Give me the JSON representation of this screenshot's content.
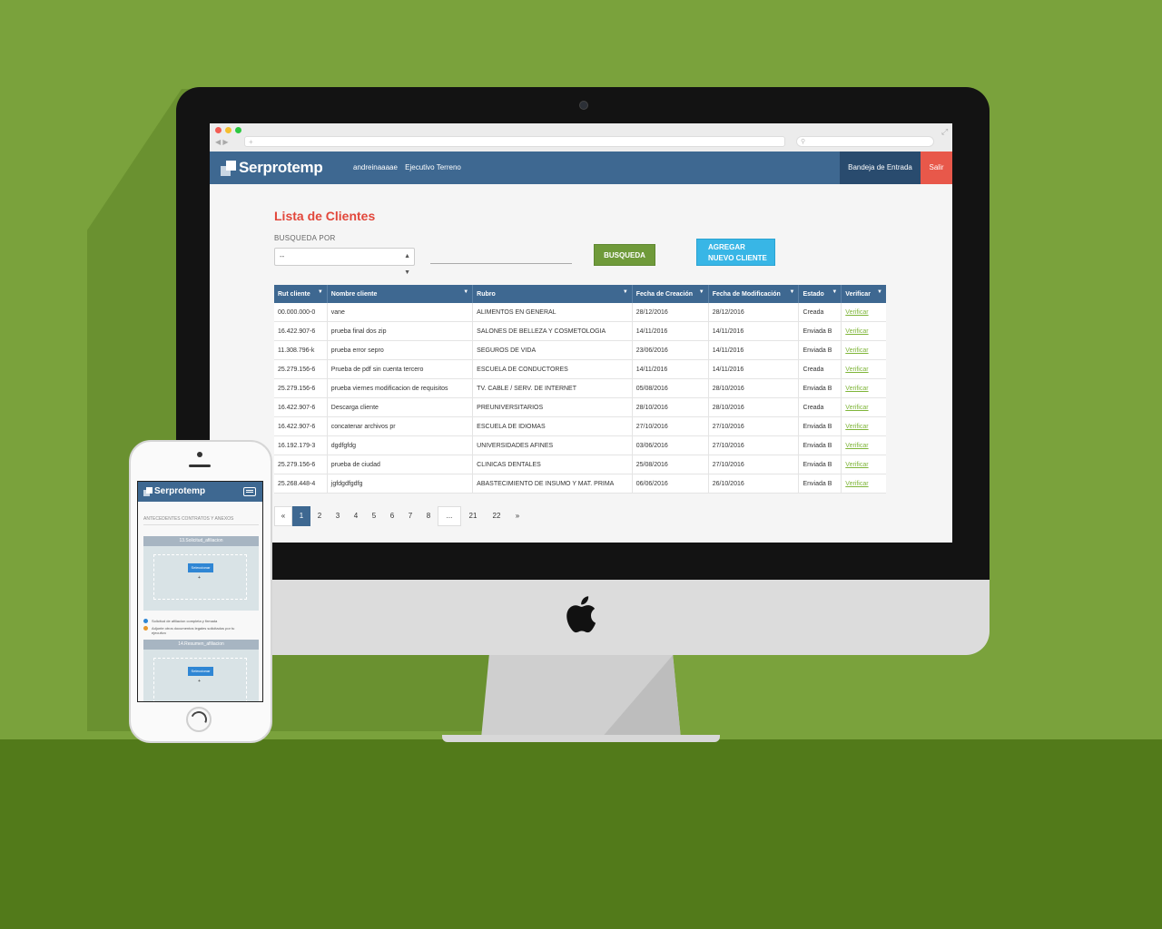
{
  "browser": {
    "url_placeholder": "+",
    "search_placeholder": "",
    "colors": {
      "close": "#f35c54",
      "minimize": "#f5be2f",
      "maximize": "#2bc840"
    }
  },
  "app": {
    "logo_text": "Serprotemp",
    "username": "andreinaaaae",
    "role": "Ejecutivo Terreno",
    "inbox_label": "Bandeja de Entrada",
    "exit_label": "Salir",
    "accent_color": "#3e6891",
    "danger_color": "#e8584a"
  },
  "page": {
    "title": "Lista de Clientes",
    "search_label": "BUSQUEDA POR",
    "select_value": "--",
    "search_button": "BUSQUEDA",
    "add_button_line1": "AGREGAR",
    "add_button_line2": "NUEVO CLIENTE"
  },
  "table": {
    "headers": [
      "Rut cliente",
      "Nombre cliente",
      "Rubro",
      "Fecha de Creación",
      "Fecha de Modificación",
      "Estado",
      "Verificar"
    ],
    "rows": [
      [
        "00.000.000-0",
        "vane",
        "ALIMENTOS EN GENERAL",
        "28/12/2016",
        "28/12/2016",
        "Creada",
        "Verificar"
      ],
      [
        "16.422.907-6",
        "prueba final dos zip",
        "SALONES DE BELLEZA Y COSMETOLOGIA",
        "14/11/2016",
        "14/11/2016",
        "Enviada B",
        "Verificar"
      ],
      [
        "11.308.796-k",
        "prueba error sepro",
        "SEGUROS DE VIDA",
        "23/06/2016",
        "14/11/2016",
        "Enviada B",
        "Verificar"
      ],
      [
        "25.279.156-6",
        "Prueba de pdf sin cuenta tercero",
        "ESCUELA DE CONDUCTORES",
        "14/11/2016",
        "14/11/2016",
        "Creada",
        "Verificar"
      ],
      [
        "25.279.156-6",
        "prueba viernes modificacion de requisitos",
        "TV. CABLE / SERV. DE INTERNET",
        "05/08/2016",
        "28/10/2016",
        "Enviada B",
        "Verificar"
      ],
      [
        "16.422.907-6",
        "Descarga cliente",
        "PREUNIVERSITARIOS",
        "28/10/2016",
        "28/10/2016",
        "Creada",
        "Verificar"
      ],
      [
        "16.422.907-6",
        "concatenar archivos pr",
        "ESCUELA DE IDIOMAS",
        "27/10/2016",
        "27/10/2016",
        "Enviada B",
        "Verificar"
      ],
      [
        "16.192.179-3",
        "dgdfgfdg",
        "UNIVERSIDADES AFINES",
        "03/06/2016",
        "27/10/2016",
        "Enviada B",
        "Verificar"
      ],
      [
        "25.279.156-6",
        "prueba de ciudad",
        "CLINICAS DENTALES",
        "25/08/2016",
        "27/10/2016",
        "Enviada B",
        "Verificar"
      ],
      [
        "25.268.448-4",
        "jgfdgdfgdfg",
        "ABASTECIMIENTO DE INSUMO Y MAT. PRIMA",
        "06/06/2016",
        "26/10/2016",
        "Enviada B",
        "Verificar"
      ]
    ]
  },
  "pagination": {
    "prev": "«",
    "pages": [
      "1",
      "2",
      "3",
      "4",
      "5",
      "6",
      "7",
      "8"
    ],
    "ellipsis": "...",
    "tail_pages": [
      "21",
      "22"
    ],
    "next": "»",
    "active": "1"
  },
  "mobile": {
    "logo_text": "Serprotemp",
    "section_title": "ANTECEDENTES CONTRATOS Y ANEXOS",
    "box1_title": "13.Solicitud_afiliacion",
    "box2_title": "14.Resumen_afiliacion",
    "select_button": "Seleccionar",
    "plus": "+",
    "note1": "Solicitud de afiliacion completa y firmada",
    "note2": "Adjunte otros documentos legales solicitados por tu ejecutivo"
  }
}
